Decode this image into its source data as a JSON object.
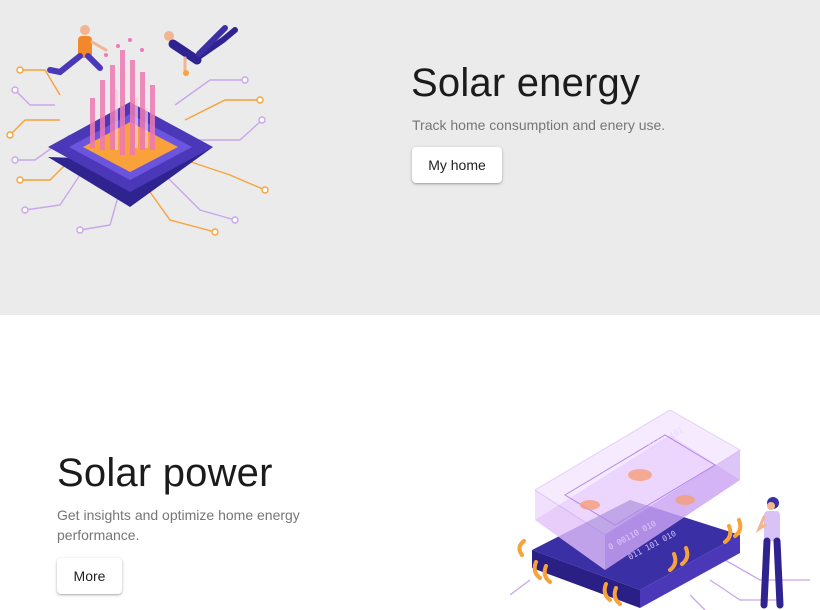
{
  "hero_energy": {
    "title": "Solar energy",
    "description": "Track home consumption and enery use.",
    "button_label": "My home"
  },
  "hero_power": {
    "title": "Solar power",
    "description": "Get insights and optimize home energy performance.",
    "button_label": "More"
  },
  "colors": {
    "top_background": "#ebebeb",
    "bottom_background": "#ffffff",
    "chip_purple": "#4a38b8",
    "accent_orange": "#f7a23a",
    "accent_pink": "#ee7ab4",
    "circuit_lilac": "#c9a6ec"
  },
  "icons": {
    "top_illustration": "circuit-chip-illustration",
    "bottom_illustration": "server-chip-illustration"
  }
}
